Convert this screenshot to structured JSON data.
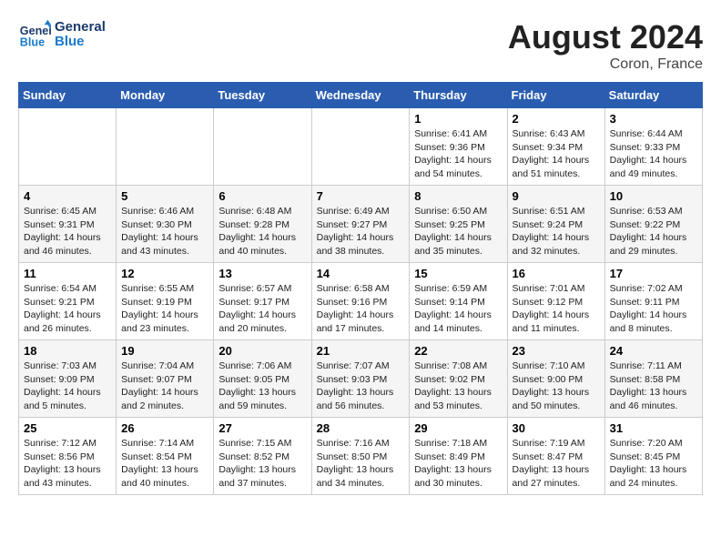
{
  "header": {
    "logo_line1": "General",
    "logo_line2": "Blue",
    "month": "August 2024",
    "location": "Coron, France"
  },
  "weekdays": [
    "Sunday",
    "Monday",
    "Tuesday",
    "Wednesday",
    "Thursday",
    "Friday",
    "Saturday"
  ],
  "weeks": [
    [
      {
        "day": "",
        "info": ""
      },
      {
        "day": "",
        "info": ""
      },
      {
        "day": "",
        "info": ""
      },
      {
        "day": "",
        "info": ""
      },
      {
        "day": "1",
        "info": "Sunrise: 6:41 AM\nSunset: 9:36 PM\nDaylight: 14 hours\nand 54 minutes."
      },
      {
        "day": "2",
        "info": "Sunrise: 6:43 AM\nSunset: 9:34 PM\nDaylight: 14 hours\nand 51 minutes."
      },
      {
        "day": "3",
        "info": "Sunrise: 6:44 AM\nSunset: 9:33 PM\nDaylight: 14 hours\nand 49 minutes."
      }
    ],
    [
      {
        "day": "4",
        "info": "Sunrise: 6:45 AM\nSunset: 9:31 PM\nDaylight: 14 hours\nand 46 minutes."
      },
      {
        "day": "5",
        "info": "Sunrise: 6:46 AM\nSunset: 9:30 PM\nDaylight: 14 hours\nand 43 minutes."
      },
      {
        "day": "6",
        "info": "Sunrise: 6:48 AM\nSunset: 9:28 PM\nDaylight: 14 hours\nand 40 minutes."
      },
      {
        "day": "7",
        "info": "Sunrise: 6:49 AM\nSunset: 9:27 PM\nDaylight: 14 hours\nand 38 minutes."
      },
      {
        "day": "8",
        "info": "Sunrise: 6:50 AM\nSunset: 9:25 PM\nDaylight: 14 hours\nand 35 minutes."
      },
      {
        "day": "9",
        "info": "Sunrise: 6:51 AM\nSunset: 9:24 PM\nDaylight: 14 hours\nand 32 minutes."
      },
      {
        "day": "10",
        "info": "Sunrise: 6:53 AM\nSunset: 9:22 PM\nDaylight: 14 hours\nand 29 minutes."
      }
    ],
    [
      {
        "day": "11",
        "info": "Sunrise: 6:54 AM\nSunset: 9:21 PM\nDaylight: 14 hours\nand 26 minutes."
      },
      {
        "day": "12",
        "info": "Sunrise: 6:55 AM\nSunset: 9:19 PM\nDaylight: 14 hours\nand 23 minutes."
      },
      {
        "day": "13",
        "info": "Sunrise: 6:57 AM\nSunset: 9:17 PM\nDaylight: 14 hours\nand 20 minutes."
      },
      {
        "day": "14",
        "info": "Sunrise: 6:58 AM\nSunset: 9:16 PM\nDaylight: 14 hours\nand 17 minutes."
      },
      {
        "day": "15",
        "info": "Sunrise: 6:59 AM\nSunset: 9:14 PM\nDaylight: 14 hours\nand 14 minutes."
      },
      {
        "day": "16",
        "info": "Sunrise: 7:01 AM\nSunset: 9:12 PM\nDaylight: 14 hours\nand 11 minutes."
      },
      {
        "day": "17",
        "info": "Sunrise: 7:02 AM\nSunset: 9:11 PM\nDaylight: 14 hours\nand 8 minutes."
      }
    ],
    [
      {
        "day": "18",
        "info": "Sunrise: 7:03 AM\nSunset: 9:09 PM\nDaylight: 14 hours\nand 5 minutes."
      },
      {
        "day": "19",
        "info": "Sunrise: 7:04 AM\nSunset: 9:07 PM\nDaylight: 14 hours\nand 2 minutes."
      },
      {
        "day": "20",
        "info": "Sunrise: 7:06 AM\nSunset: 9:05 PM\nDaylight: 13 hours\nand 59 minutes."
      },
      {
        "day": "21",
        "info": "Sunrise: 7:07 AM\nSunset: 9:03 PM\nDaylight: 13 hours\nand 56 minutes."
      },
      {
        "day": "22",
        "info": "Sunrise: 7:08 AM\nSunset: 9:02 PM\nDaylight: 13 hours\nand 53 minutes."
      },
      {
        "day": "23",
        "info": "Sunrise: 7:10 AM\nSunset: 9:00 PM\nDaylight: 13 hours\nand 50 minutes."
      },
      {
        "day": "24",
        "info": "Sunrise: 7:11 AM\nSunset: 8:58 PM\nDaylight: 13 hours\nand 46 minutes."
      }
    ],
    [
      {
        "day": "25",
        "info": "Sunrise: 7:12 AM\nSunset: 8:56 PM\nDaylight: 13 hours\nand 43 minutes."
      },
      {
        "day": "26",
        "info": "Sunrise: 7:14 AM\nSunset: 8:54 PM\nDaylight: 13 hours\nand 40 minutes."
      },
      {
        "day": "27",
        "info": "Sunrise: 7:15 AM\nSunset: 8:52 PM\nDaylight: 13 hours\nand 37 minutes."
      },
      {
        "day": "28",
        "info": "Sunrise: 7:16 AM\nSunset: 8:50 PM\nDaylight: 13 hours\nand 34 minutes."
      },
      {
        "day": "29",
        "info": "Sunrise: 7:18 AM\nSunset: 8:49 PM\nDaylight: 13 hours\nand 30 minutes."
      },
      {
        "day": "30",
        "info": "Sunrise: 7:19 AM\nSunset: 8:47 PM\nDaylight: 13 hours\nand 27 minutes."
      },
      {
        "day": "31",
        "info": "Sunrise: 7:20 AM\nSunset: 8:45 PM\nDaylight: 13 hours\nand 24 minutes."
      }
    ]
  ]
}
